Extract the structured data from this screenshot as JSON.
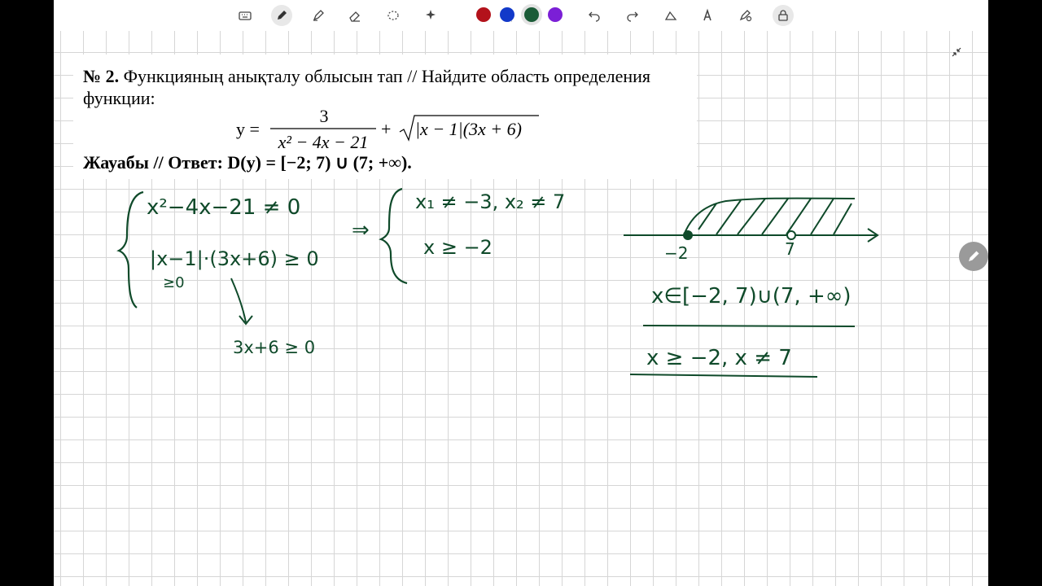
{
  "toolbar": {
    "tools": [
      "keyboard-icon",
      "pen-icon",
      "highlighter-icon",
      "eraser-icon",
      "lasso-icon",
      "magic-icon"
    ],
    "colors": [
      "#b3121b",
      "#1239c9",
      "#1b5c38",
      "#7b1fd6"
    ],
    "selected_color": "#1b5c38",
    "actions": [
      "undo-icon",
      "redo-icon",
      "shape-icon",
      "text-recognition-icon",
      "pen-settings-icon",
      "lock-icon"
    ]
  },
  "problem": {
    "number": "№ 2.",
    "statement_line1": "Функцияның анықталу облысын тап // Найдите область определения",
    "statement_line2": "функции:",
    "formula_y": "y =",
    "formula_numerator": "3",
    "formula_denominator": "x² − 4x − 21",
    "formula_plus": "+",
    "formula_radicand": "|x − 1|(3x + 6)",
    "answer_label": "Жауабы // Ответ:",
    "answer_value": "D(y) = [−2; 7) ∪ (7; +∞)."
  },
  "handwriting": {
    "sys1_line1": "x²−4x−21 ≠ 0",
    "sys1_line2": "|x−1|·(3x+6) ≥ 0",
    "sys1_note": "≥0",
    "arrow_result": "3x+6 ≥ 0",
    "implies": "⇒",
    "sys2_line1": "x₁ ≠ −3,   x₂ ≠ 7",
    "sys2_line2": "x ≥ −2",
    "axis_label_left": "−2",
    "axis_label_right": "7",
    "interval_answer": "x∈[−2, 7)∪(7, +∞)",
    "final_answer": "x ≥ −2, x ≠ 7"
  }
}
